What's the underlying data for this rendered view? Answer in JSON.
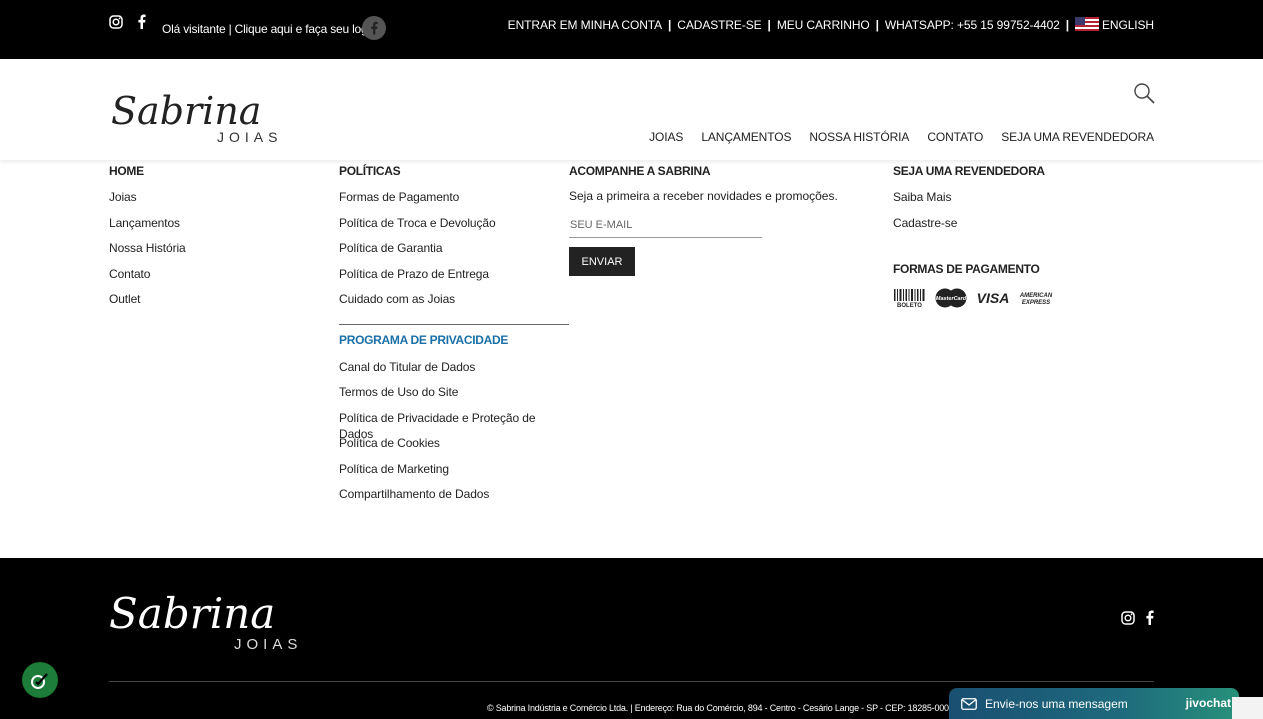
{
  "topbar": {
    "login_text": "Olá visitante | Clique aqui e faça seu login.",
    "links": [
      "ENTRAR EM MINHA CONTA",
      "CADASTRE-SE",
      "MEU CARRINHO",
      "WHATSAPP: +55 15 99752-4402"
    ],
    "language": "ENGLISH",
    "social_icons": [
      "instagram-icon",
      "facebook-icon"
    ]
  },
  "header": {
    "logo_script": "Sabrina",
    "logo_sub": "JOIAS",
    "nav": [
      "JOIAS",
      "LANÇAMENTOS",
      "NOSSA HISTÓRIA",
      "CONTATO",
      "SEJA UMA REVENDEDORA"
    ]
  },
  "footer_menu": {
    "home": {
      "title": "HOME",
      "items": [
        "Joias",
        "Lançamentos",
        "Nossa História",
        "Contato",
        "Outlet"
      ]
    },
    "policies": {
      "title": "POLÍTICAS",
      "items": [
        "Formas de Pagamento",
        "Política de Troca e Devolução",
        "Política de Garantia",
        "Política de Prazo de Entrega",
        "Cuidado com as Joias"
      ],
      "privacy_title": "PROGRAMA DE PRIVACIDADE",
      "privacy_items": [
        "Canal do Titular de Dados",
        "Termos de Uso do Site",
        "Política de Privacidade e Proteção de Dados",
        "Política de Cookies",
        "Política de Marketing",
        "Compartilhamento de Dados"
      ]
    },
    "newsletter": {
      "title": "ACOMPANHE A SABRINA",
      "text": "Seja a primeira a receber novidades e promoções.",
      "placeholder": "SEU E-MAIL",
      "button": "ENVIAR"
    },
    "reseller": {
      "title": "SEJA UMA REVENDEDORA",
      "items": [
        "Saiba Mais",
        "Cadastre-se"
      ],
      "payment_title": "FORMAS DE PAGAMENTO",
      "payment_icons": [
        "boleto-icon",
        "mastercard-icon",
        "visa-icon",
        "american-express-icon"
      ]
    }
  },
  "footer": {
    "legal": "© Sabrina Indústria e Comércio Ltda. | Endereço: Rua do Comércio, 894 - Centro - Cesário Lange - SP - CEP: 18285-000 | CN"
  },
  "chat": {
    "label": "Envie-nos uma mensagem",
    "brand": "jivochat"
  }
}
